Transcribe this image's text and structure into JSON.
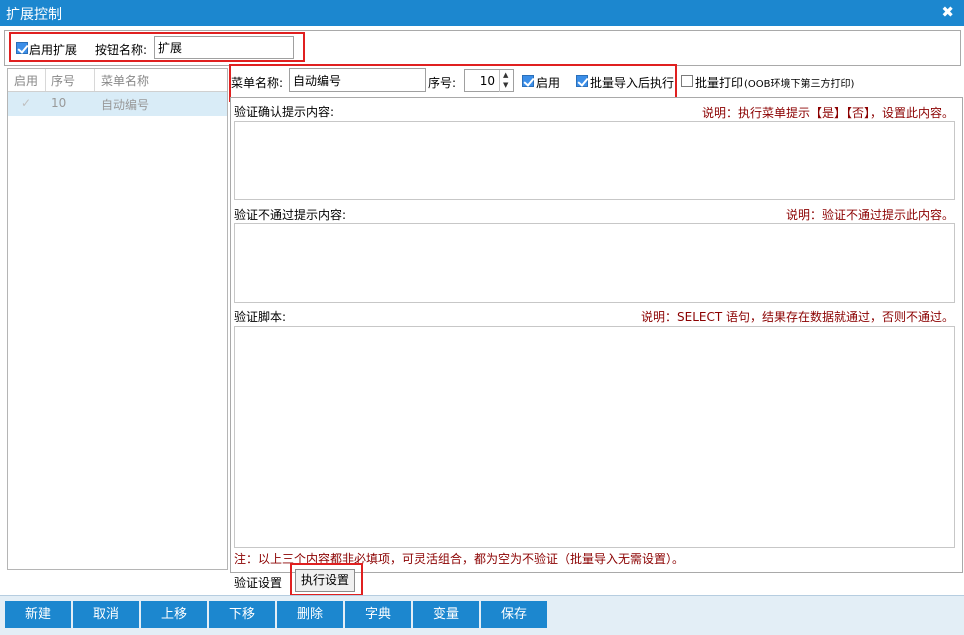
{
  "window": {
    "title": "扩展控制",
    "close_glyph": "✖"
  },
  "topbar": {
    "enable_ext_label": "启用扩展",
    "enable_ext_checked": true,
    "button_name_label": "按钮名称:",
    "button_name_value": "扩展"
  },
  "list": {
    "columns": [
      "启用",
      "序号",
      "菜单名称"
    ],
    "rows": [
      {
        "enabled": "✓",
        "seq": "10",
        "name": "自动编号"
      }
    ]
  },
  "form": {
    "menu_name_label": "菜单名称:",
    "menu_name_value": "自动编号",
    "seq_label": "序号:",
    "seq_value": "10",
    "enable_label": "启用",
    "batch_import_label": "批量导入后执行",
    "batch_print_label": "批量打印",
    "batch_print_note": "(OOB环境下第三方打印)"
  },
  "sections": {
    "confirm_label": "验证确认提示内容:",
    "confirm_note": "说明：执行菜单提示【是】【否】，设置此内容。",
    "fail_label": "验证不通过提示内容:",
    "fail_note": "说明：验证不通过提示此内容。",
    "script_label": "验证脚本:",
    "script_note": "说明：SELECT 语句，结果存在数据就通过，否则不通过。",
    "footer_note": "注：以上三个内容都非必填项，可灵活组合，都为空为不验证（批量导入无需设置）。"
  },
  "tabs": {
    "verify": "验证设置",
    "execute": "执行设置"
  },
  "buttons": [
    "新建",
    "取消",
    "上移",
    "下移",
    "删除",
    "字典",
    "变量",
    "保存"
  ],
  "colors": {
    "title_bar": "#1c87cf",
    "note_text": "#8b0000",
    "highlight": "#e02020"
  }
}
